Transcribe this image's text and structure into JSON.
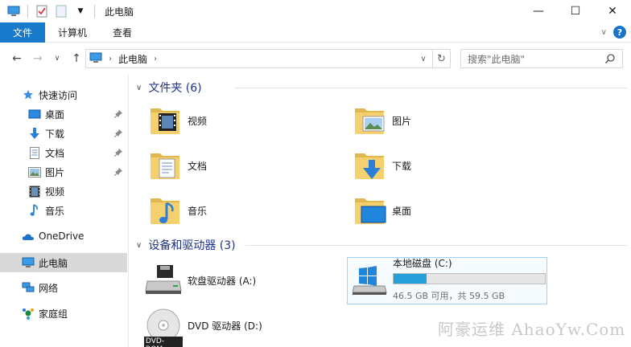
{
  "window": {
    "title": "此电脑",
    "minimize": "—",
    "maximize": "☐",
    "close": "✕"
  },
  "ribbon": {
    "tabs": [
      "文件",
      "计算机",
      "查看"
    ],
    "expand": "∨",
    "help": "?"
  },
  "address": {
    "location": "此电脑",
    "search_placeholder": "搜索\"此电脑\""
  },
  "nav": {
    "quick_access": "快速访问",
    "quick_items": [
      "桌面",
      "下载",
      "文档",
      "图片",
      "视频",
      "音乐"
    ],
    "onedrive": "OneDrive",
    "this_pc": "此电脑",
    "network": "网络",
    "homegroup": "家庭组"
  },
  "folders_group": "文件夹 (6)",
  "folders": [
    {
      "name": "视频",
      "icon": "video-folder-icon"
    },
    {
      "name": "图片",
      "icon": "pictures-folder-icon"
    },
    {
      "name": "文档",
      "icon": "documents-folder-icon"
    },
    {
      "name": "下载",
      "icon": "downloads-folder-icon"
    },
    {
      "name": "音乐",
      "icon": "music-folder-icon"
    },
    {
      "name": "桌面",
      "icon": "desktop-folder-icon"
    }
  ],
  "devices_group": "设备和驱动器 (3)",
  "drives": {
    "floppy": {
      "name": "软盘驱动器 (A:)"
    },
    "local_c": {
      "name": "本地磁盘 (C:)",
      "free_text": "46.5 GB 可用，共 59.5 GB",
      "used_fraction": 0.22
    },
    "dvd": {
      "name": "DVD 驱动器 (D:)",
      "badge": "DVD-ROM"
    }
  },
  "watermark": "阿豪运维 AhaoYw.Com",
  "colors": {
    "accent": "#1979ca",
    "group_header": "#1e3287",
    "progress": "#26a0da",
    "folder": "#f4d06f"
  }
}
